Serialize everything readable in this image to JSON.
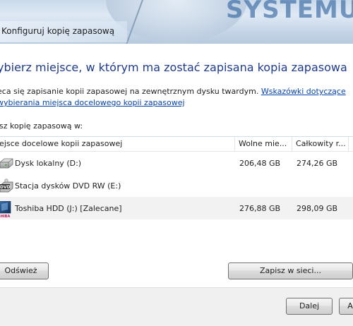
{
  "window": {
    "title": "Konfiguruj kopię zapasową",
    "background_brand": "SYSTEMU"
  },
  "main": {
    "heading": "ybierz miejsce, w którym ma zostać zapisana kopia zapasowa",
    "description_text": "eca się zapisanie kopii zapasowej na zewnętrznym dysku twardym.",
    "help_link": "Wskazówki dotyczące wybierania miejsca docelowego kopii zapasowej",
    "choose_label": "isz kopię zapasową w:"
  },
  "table": {
    "columns": [
      "iejsce docelowe kopii zapasowej",
      "Wolne mie...",
      "Całkowity r..."
    ],
    "rows": [
      {
        "name": "Dysk lokalny (D:)",
        "free": "206,48 GB",
        "total": "274,26 GB",
        "icon": "hard-drive-icon",
        "selected": false
      },
      {
        "name": "Stacja dysków DVD RW (E:)",
        "free": "",
        "total": "",
        "icon": "dvd-drive-icon",
        "selected": false
      },
      {
        "name": "Toshiba HDD (J:) [Zalecane]",
        "free": "276,88 GB",
        "total": "298,09 GB",
        "icon": "toshiba-drive-icon",
        "selected": true
      }
    ]
  },
  "buttons": {
    "refresh": "Odśwież",
    "save_network": "Zapisz w sieci...",
    "next": "Dalej",
    "cut_off": "A"
  },
  "colors": {
    "heading": "#1e3a8a",
    "link": "#0645ad",
    "selected_row": "#f2f2f2"
  }
}
